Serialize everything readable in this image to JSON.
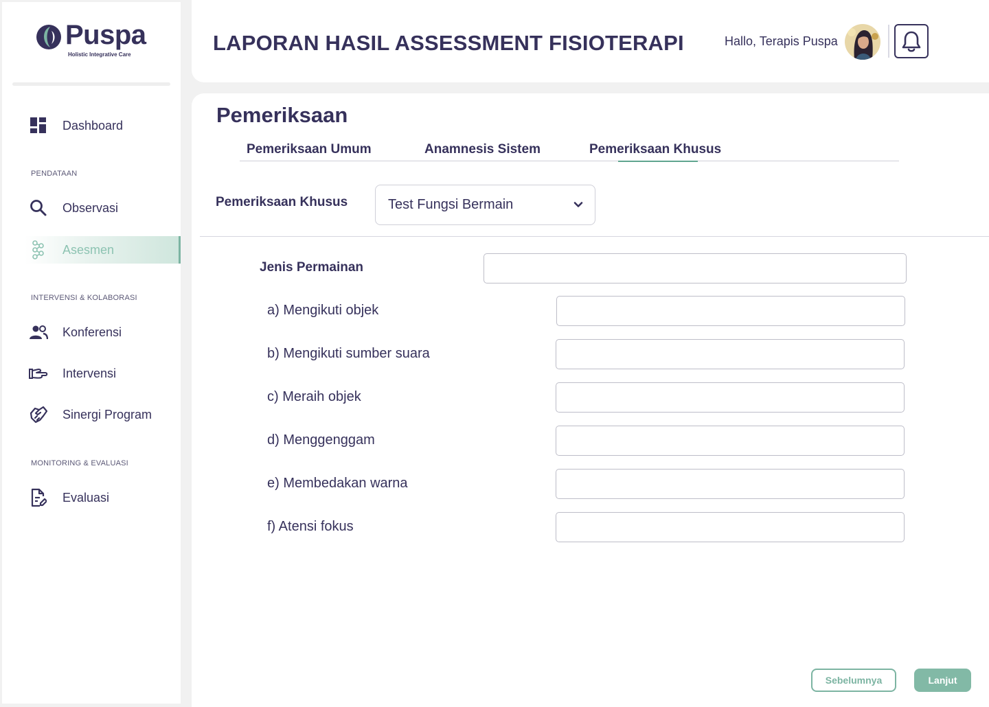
{
  "brand": {
    "name": "Puspa",
    "tagline": "Holistic Integrative Care"
  },
  "sidebar": {
    "dashboard": {
      "label": "Dashboard",
      "icon": "dashboard-icon"
    },
    "sections": [
      {
        "label": "PENDATAAN"
      },
      {
        "label": "INTERVENSI & KOLABORASI"
      },
      {
        "label": "MONITORING & EVALUASI"
      }
    ],
    "items": [
      {
        "label": "Observasi",
        "icon": "search-icon"
      },
      {
        "label": "Asesmen",
        "icon": "assessment-icon",
        "active": true
      },
      {
        "label": "Konferensi",
        "icon": "people-icon"
      },
      {
        "label": "Intervensi",
        "icon": "hand-icon"
      },
      {
        "label": "Sinergi Program",
        "icon": "handshake-icon"
      },
      {
        "label": "Evaluasi",
        "icon": "document-edit-icon"
      }
    ]
  },
  "header": {
    "title": "LAPORAN HASIL ASSESSMENT FISIOTERAPI",
    "greeting": "Hallo, Terapis Puspa",
    "notification_icon": "bell-icon"
  },
  "main": {
    "section_title": "Pemeriksaan",
    "tabs": [
      {
        "label": "Pemeriksaan Umum"
      },
      {
        "label": "Anamnesis Sistem"
      },
      {
        "label": "Pemeriksaan Khusus",
        "active": true
      }
    ],
    "filter": {
      "label": "Pemeriksaan Khusus",
      "selected": "Test Fungsi Bermain"
    },
    "form": {
      "main_label": "Jenis Permainan",
      "main_value": "",
      "fields": [
        {
          "label": "a) Mengikuti objek",
          "value": ""
        },
        {
          "label": "b) Mengikuti sumber suara",
          "value": ""
        },
        {
          "label": "c) Meraih objek",
          "value": ""
        },
        {
          "label": "d) Menggenggam",
          "value": ""
        },
        {
          "label": "e) Membedakan warna",
          "value": ""
        },
        {
          "label": "f) Atensi fokus",
          "value": ""
        }
      ]
    },
    "buttons": {
      "prev": "Sebelumnya",
      "next": "Lanjut"
    }
  },
  "colors": {
    "primary": "#36315b",
    "accent": "#7cb4a2",
    "accent_fill": "#82b9a6"
  }
}
